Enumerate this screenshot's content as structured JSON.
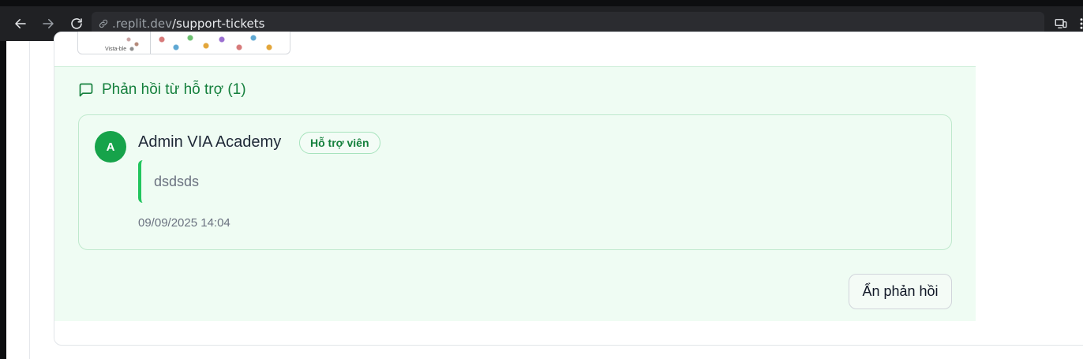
{
  "browser": {
    "url_host": ".replit.dev",
    "url_path": "/support-tickets",
    "icons": [
      "back-icon",
      "forward-icon",
      "reload-icon",
      "link-icon",
      "devices-icon",
      "more-vert-icon"
    ]
  },
  "attachment": {
    "caption": "Vista-ble",
    "icon": "image-thumbnail"
  },
  "reply_section": {
    "title": "Phản hồi từ hỗ trợ (1)",
    "icon": "message-square-icon",
    "accent_color": "#15803d",
    "background_color": "#effcf3"
  },
  "replies": [
    {
      "avatar_letter": "A",
      "author": "Admin VIA Academy",
      "role_badge": "Hỗ trợ viên",
      "message": "dsdsds",
      "timestamp": "09/09/2025 14:04"
    }
  ],
  "actions": {
    "hide_replies_label": "Ẩn phản hồi"
  }
}
